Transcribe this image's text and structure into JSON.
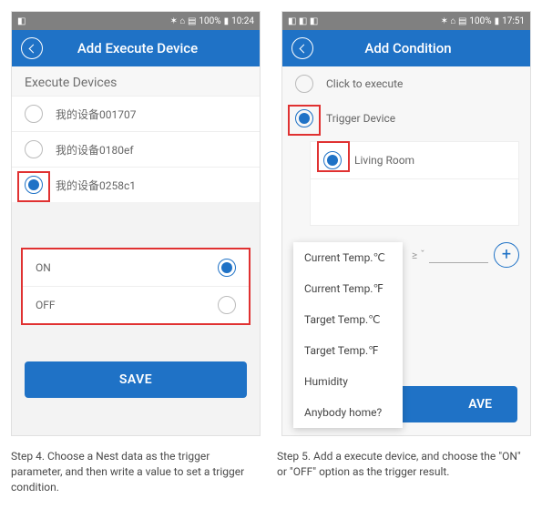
{
  "statusbar": {
    "left_time": "10:24",
    "right_time": "17:51",
    "battery": "100%"
  },
  "left": {
    "appbar_title": "Add Execute Device",
    "section_title": "Execute Devices",
    "devices": [
      {
        "label": "我的设备001707",
        "selected": false
      },
      {
        "label": "我的设备0180ef",
        "selected": false
      },
      {
        "label": "我的设备0258c1",
        "selected": true
      }
    ],
    "on_label": "ON",
    "off_label": "OFF",
    "save_label": "SAVE"
  },
  "right": {
    "appbar_title": "Add Condition",
    "option_click": "Click to execute",
    "option_trigger": "Trigger Device",
    "nested_device": "Living Room",
    "dropdown": [
      "Current Temp.℃",
      "Current Temp.℉",
      "Target Temp.℃",
      "Target Temp.℉",
      "Humidity",
      "Anybody home?"
    ],
    "operator_hint": "≥ ˇ",
    "save_label": "SAVE",
    "save_visible": "AVE"
  },
  "captions": {
    "step4": "Step 4. Choose a Nest data as the trigger parameter, and then write a value to set a trigger condition.",
    "step5": "Step 5. Add a execute device, and choose the \"ON\" or \"OFF\" option as the trigger result."
  }
}
